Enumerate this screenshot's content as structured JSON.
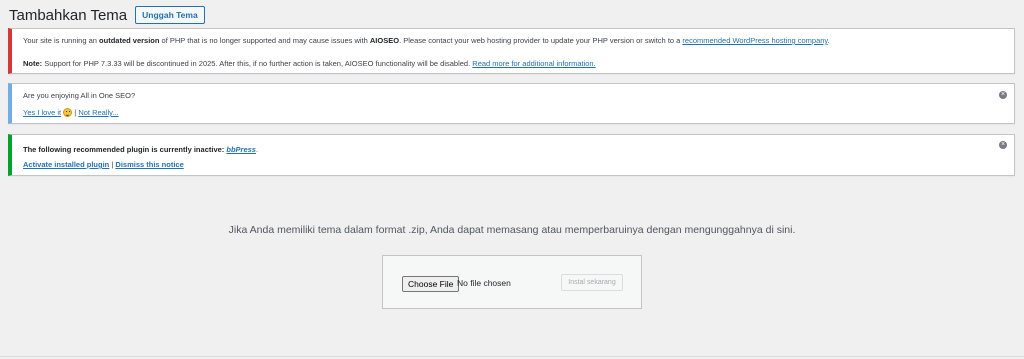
{
  "header": {
    "title": "Tambahkan Tema",
    "upload_button": "Unggah Tema"
  },
  "notices": {
    "php": {
      "line1_pre": "Your site is running an ",
      "line1_bold": "outdated version",
      "line1_mid": " of PHP that is no longer supported and may cause issues with ",
      "line1_bold2": "AIOSEO",
      "line1_post": ". Please contact your web hosting provider to update your PHP version or switch to a ",
      "line1_link": "recommended WordPress hosting company",
      "line1_end": ".",
      "line2_bold": "Note:",
      "line2_text": " Support for PHP 7.3.33 will be discontinued in 2025. After this, if no further action is taken, AIOSEO functionality will be disabled. ",
      "line2_link": "Read more for additional information."
    },
    "aioseo": {
      "question": "Are you enjoying All in One SEO?",
      "yes_link": "Yes I love it",
      "separator": "|",
      "no_link": "Not Really..."
    },
    "plugin": {
      "text_bold": "The following recommended plugin is currently inactive: ",
      "plugin_link": "bbPress",
      "text_end": ".",
      "activate_link": "Activate installed plugin",
      "separator": "|",
      "dismiss_link": "Dismiss this notice"
    }
  },
  "upload": {
    "instructions": "Jika Anda memiliki tema dalam format .zip, Anda dapat memasang atau memperbaruinya dengan mengunggahnya di sini.",
    "choose_file": "Choose File",
    "file_status": "No file chosen",
    "install_button": "Instal sekarang"
  },
  "icons": {
    "dismiss": "close-circle-icon",
    "smile": "smile-emoji-icon"
  },
  "colors": {
    "error": "#d63638",
    "info": "#72aee6",
    "success": "#00a32a",
    "link": "#2271b1"
  }
}
